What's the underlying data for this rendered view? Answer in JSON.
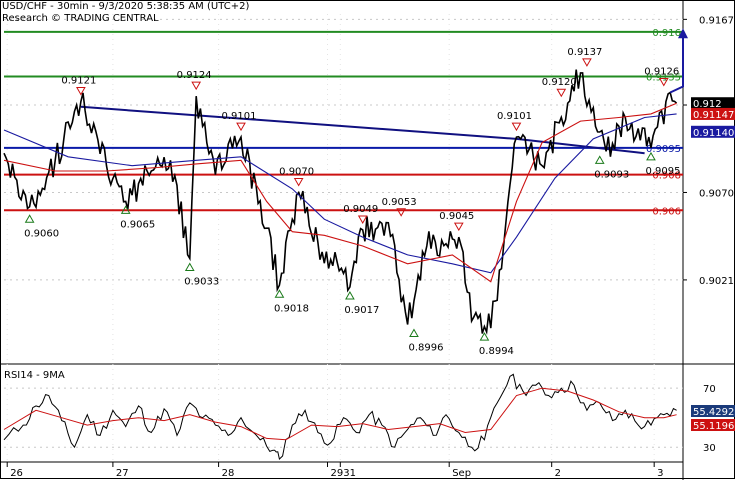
{
  "header": {
    "line1": "USD/CHF - 30min - 9/3/2020 5:38:35 AM (UTC+2)",
    "line2": "Research © TRADING CENTRAL"
  },
  "colors": {
    "price": "#000000",
    "ma_fast": "#cc1111",
    "ma_slow": "#1a1aa0",
    "resistance": "#228b22",
    "support": "#cc1111",
    "trendline": "#101080",
    "pivot_line": "#0a1aa8",
    "arrow": "#1a1aa0",
    "last_price_bg": "#000000",
    "ma_fast_tag_bg": "#cc1111",
    "ma_slow_tag_bg": "#1a1aa0",
    "rsi_tag_bg": "#1a3a7a",
    "rsi_ma_tag_bg": "#cc1111"
  },
  "chart_data": [
    {
      "type": "line",
      "title": "USD/CHF - 30min",
      "ylim": [
        0.8975,
        0.917
      ],
      "yticks": [
        "0.9167",
        "0.9119",
        "0.9070",
        "0.9021"
      ],
      "x_labels": [
        "26",
        "27",
        "28",
        "29",
        "31",
        "Sep",
        "2",
        "3"
      ],
      "x_label_positions": [
        0.5,
        17,
        33.5,
        50.5,
        52.5,
        69.5,
        85.5,
        101.5
      ],
      "bars": 106,
      "series": [
        {
          "key": "price",
          "points": [
            [
              0,
              0.9092
            ],
            [
              4,
              0.9062
            ],
            [
              8,
              0.9088
            ],
            [
              12,
              0.9121
            ],
            [
              16,
              0.9085
            ],
            [
              19,
              0.9065
            ],
            [
              23,
              0.9082
            ],
            [
              26,
              0.9088
            ],
            [
              29,
              0.9033
            ],
            [
              30,
              0.9124
            ],
            [
              33,
              0.908
            ],
            [
              37,
              0.9101
            ],
            [
              41,
              0.905
            ],
            [
              43,
              0.9018
            ],
            [
              45,
              0.9055
            ],
            [
              46,
              0.907
            ],
            [
              49,
              0.9042
            ],
            [
              54,
              0.9017
            ],
            [
              56,
              0.9049
            ],
            [
              60,
              0.9053
            ],
            [
              63,
              0.8996
            ],
            [
              66,
              0.904
            ],
            [
              71,
              0.9045
            ],
            [
              73,
              0.8998
            ],
            [
              76,
              0.8994
            ],
            [
              78,
              0.904
            ],
            [
              80,
              0.9101
            ],
            [
              84,
              0.9085
            ],
            [
              88,
              0.912
            ],
            [
              90,
              0.9137
            ],
            [
              94,
              0.9093
            ],
            [
              97,
              0.9112
            ],
            [
              101,
              0.9095
            ],
            [
              104,
              0.9126
            ],
            [
              105,
              0.912
            ]
          ]
        },
        {
          "key": "ma_fast",
          "points": [
            [
              0,
              0.9088
            ],
            [
              8,
              0.9082
            ],
            [
              16,
              0.9082
            ],
            [
              24,
              0.9084
            ],
            [
              30,
              0.9086
            ],
            [
              37,
              0.9088
            ],
            [
              41,
              0.9065
            ],
            [
              45,
              0.9048
            ],
            [
              50,
              0.9046
            ],
            [
              56,
              0.904
            ],
            [
              63,
              0.903
            ],
            [
              70,
              0.9035
            ],
            [
              76,
              0.902
            ],
            [
              80,
              0.9065
            ],
            [
              84,
              0.9098
            ],
            [
              90,
              0.911
            ],
            [
              96,
              0.9112
            ],
            [
              101,
              0.9114
            ],
            [
              105,
              0.912
            ]
          ]
        },
        {
          "key": "ma_slow",
          "points": [
            [
              0,
              0.9105
            ],
            [
              10,
              0.909
            ],
            [
              20,
              0.9085
            ],
            [
              30,
              0.9088
            ],
            [
              37,
              0.909
            ],
            [
              45,
              0.9072
            ],
            [
              50,
              0.9055
            ],
            [
              56,
              0.9045
            ],
            [
              63,
              0.9035
            ],
            [
              70,
              0.903
            ],
            [
              76,
              0.9025
            ],
            [
              80,
              0.9045
            ],
            [
              86,
              0.9078
            ],
            [
              92,
              0.91
            ],
            [
              100,
              0.9112
            ],
            [
              105,
              0.9114
            ]
          ]
        }
      ],
      "levels": [
        {
          "key": "res2",
          "value": 0.916,
          "label": "0.916",
          "color_key": "resistance"
        },
        {
          "key": "res1",
          "value": 0.9135,
          "label": "0.9135",
          "color_key": "resistance"
        },
        {
          "key": "pivot",
          "value": 0.9095,
          "label": "0.9095",
          "color_key": "pivot_line"
        },
        {
          "key": "sup1",
          "value": 0.908,
          "label": "0.908",
          "color_key": "support"
        },
        {
          "key": "sup2",
          "value": 0.906,
          "label": "0.906",
          "color_key": "support"
        }
      ],
      "trendline": [
        [
          12,
          0.9118
        ],
        [
          80,
          0.91
        ],
        [
          100,
          0.9092
        ]
      ],
      "forecast_arrow": [
        [
          104,
          0.9126
        ],
        [
          106,
          0.9162
        ]
      ],
      "annotations": [
        {
          "x": 4,
          "y": 0.906,
          "label": "0.9060",
          "kind": "low"
        },
        {
          "x": 12,
          "y": 0.9121,
          "label": "0.9121",
          "kind": "high"
        },
        {
          "x": 19,
          "y": 0.9065,
          "label": "0.9065",
          "kind": "low"
        },
        {
          "x": 29,
          "y": 0.9033,
          "label": "0.9033",
          "kind": "low"
        },
        {
          "x": 30,
          "y": 0.9124,
          "label": "0.9124",
          "kind": "high"
        },
        {
          "x": 37,
          "y": 0.9101,
          "label": "0.9101",
          "kind": "high"
        },
        {
          "x": 43,
          "y": 0.9018,
          "label": "0.9018",
          "kind": "low"
        },
        {
          "x": 46,
          "y": 0.907,
          "label": "0.9070",
          "kind": "high"
        },
        {
          "x": 54,
          "y": 0.9017,
          "label": "0.9017",
          "kind": "low"
        },
        {
          "x": 56,
          "y": 0.9049,
          "label": "0.9049",
          "kind": "high"
        },
        {
          "x": 62,
          "y": 0.9053,
          "label": "0.9053",
          "kind": "high"
        },
        {
          "x": 64,
          "y": 0.8996,
          "label": "0.8996",
          "kind": "low"
        },
        {
          "x": 71,
          "y": 0.9045,
          "label": "0.9045",
          "kind": "high"
        },
        {
          "x": 75,
          "y": 0.8994,
          "label": "0.8994",
          "kind": "low"
        },
        {
          "x": 80,
          "y": 0.9101,
          "label": "0.9101",
          "kind": "high"
        },
        {
          "x": 87,
          "y": 0.912,
          "label": "0.9120",
          "kind": "high"
        },
        {
          "x": 91,
          "y": 0.9137,
          "label": "0.9137",
          "kind": "high"
        },
        {
          "x": 93,
          "y": 0.9093,
          "label": "0.9093",
          "kind": "low"
        },
        {
          "x": 101,
          "y": 0.9095,
          "label": "0.9095",
          "kind": "low"
        },
        {
          "x": 103,
          "y": 0.9126,
          "label": "0.9126",
          "kind": "high"
        }
      ],
      "price_tags": [
        {
          "value": 0.912,
          "label": "0.912",
          "bg_key": "last_price_bg"
        },
        {
          "value": 0.9114,
          "label": "0.91147",
          "bg_key": "ma_fast_tag_bg"
        },
        {
          "value": 0.9104,
          "label": "0.91140",
          "bg_key": "ma_slow_tag_bg"
        }
      ]
    },
    {
      "type": "line",
      "title": "RSI14 - 9MA",
      "ylim": [
        20,
        85
      ],
      "yticks": [
        "70",
        "30"
      ],
      "series": [
        {
          "key": "rsi",
          "points": [
            [
              0,
              35
            ],
            [
              3,
              45
            ],
            [
              5,
              58
            ],
            [
              7,
              65
            ],
            [
              9,
              48
            ],
            [
              11,
              30
            ],
            [
              13,
              52
            ],
            [
              15,
              38
            ],
            [
              17,
              55
            ],
            [
              19,
              44
            ],
            [
              21,
              58
            ],
            [
              23,
              40
            ],
            [
              25,
              56
            ],
            [
              27,
              38
            ],
            [
              29,
              60
            ],
            [
              31,
              50
            ],
            [
              33,
              45
            ],
            [
              35,
              38
            ],
            [
              37,
              50
            ],
            [
              40,
              35
            ],
            [
              42,
              28
            ],
            [
              43,
              22
            ],
            [
              45,
              45
            ],
            [
              47,
              55
            ],
            [
              49,
              40
            ],
            [
              51,
              33
            ],
            [
              53,
              50
            ],
            [
              55,
              40
            ],
            [
              57,
              52
            ],
            [
              59,
              45
            ],
            [
              61,
              30
            ],
            [
              63,
              42
            ],
            [
              65,
              50
            ],
            [
              67,
              38
            ],
            [
              69,
              52
            ],
            [
              71,
              40
            ],
            [
              73,
              30
            ],
            [
              75,
              35
            ],
            [
              77,
              60
            ],
            [
              79,
              78
            ],
            [
              81,
              68
            ],
            [
              83,
              72
            ],
            [
              85,
              65
            ],
            [
              87,
              70
            ],
            [
              89,
              72
            ],
            [
              91,
              55
            ],
            [
              93,
              60
            ],
            [
              95,
              48
            ],
            [
              97,
              55
            ],
            [
              99,
              45
            ],
            [
              101,
              45
            ],
            [
              103,
              52
            ],
            [
              105,
              55
            ]
          ]
        },
        {
          "key": "rsi_ma",
          "points": [
            [
              0,
              42
            ],
            [
              5,
              55
            ],
            [
              9,
              50
            ],
            [
              13,
              45
            ],
            [
              17,
              48
            ],
            [
              21,
              50
            ],
            [
              25,
              48
            ],
            [
              29,
              52
            ],
            [
              33,
              47
            ],
            [
              37,
              44
            ],
            [
              41,
              36
            ],
            [
              44,
              35
            ],
            [
              48,
              45
            ],
            [
              52,
              44
            ],
            [
              56,
              46
            ],
            [
              60,
              42
            ],
            [
              64,
              44
            ],
            [
              68,
              46
            ],
            [
              72,
              40
            ],
            [
              76,
              42
            ],
            [
              80,
              65
            ],
            [
              84,
              70
            ],
            [
              88,
              68
            ],
            [
              92,
              62
            ],
            [
              96,
              54
            ],
            [
              100,
              50
            ],
            [
              103,
              50
            ],
            [
              105,
              52
            ]
          ]
        }
      ],
      "value_tags": [
        {
          "value": 58,
          "label": "55.4292",
          "bg_key": "rsi_tag_bg"
        },
        {
          "value": 50,
          "label": "55.1196",
          "bg_key": "rsi_ma_tag_bg"
        }
      ]
    }
  ]
}
